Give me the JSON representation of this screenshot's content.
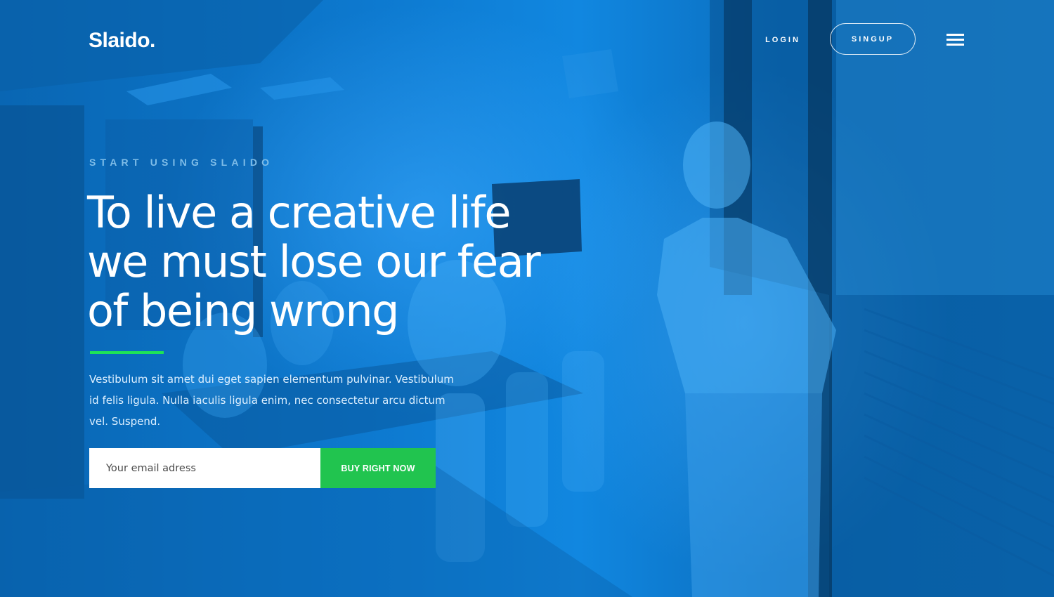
{
  "header": {
    "logo_text": "Slaido.",
    "login_label": "LOGIN",
    "signup_label": "SINGUP",
    "menu_icon": "hamburger-menu-icon"
  },
  "hero": {
    "eyebrow": "START USING SLAIDO",
    "headline_lines": [
      "To live a creative life",
      "we must lose our fear",
      "of being wrong"
    ],
    "intro": "Vestibulum sit amet dui eget sapien elementum pulvinar. Vestibulum id felis ligula. Nulla iaculis ligula enim, nec consectetur arcu dictum vel. Suspend.",
    "email_placeholder": "Your email adress",
    "buy_button_label": "BUY RIGHT NOW"
  },
  "colors": {
    "background_tint": "#0a6fc0",
    "accent_green": "#1ee356",
    "button_green": "#21c44f",
    "eyebrow_blue": "#7fbde8"
  }
}
